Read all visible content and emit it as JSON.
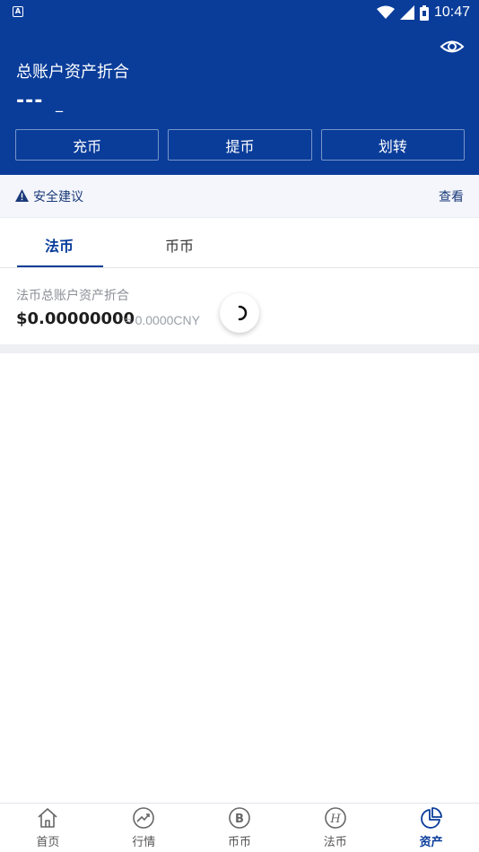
{
  "status_bar": {
    "time": "10:47",
    "app_icon_letter": "A"
  },
  "header": {
    "title": "总账户资产折合",
    "value": "---",
    "unit": "_",
    "actions": [
      "充币",
      "提币",
      "划转"
    ]
  },
  "notice": {
    "text": "安全建议",
    "link": "查看"
  },
  "tabs": [
    {
      "label": "法币",
      "active": true
    },
    {
      "label": "币币",
      "active": false
    }
  ],
  "balance": {
    "label": "法币总账户资产折合",
    "value": "$0.00000000",
    "cny": "≈ 0.0000CNY"
  },
  "bottom_nav": [
    {
      "label": "首页",
      "icon": "home-icon"
    },
    {
      "label": "行情",
      "icon": "trend-icon"
    },
    {
      "label": "币币",
      "icon": "bitcoin-icon"
    },
    {
      "label": "法币",
      "icon": "fiat-icon"
    },
    {
      "label": "资产",
      "icon": "pie-chart-icon",
      "active": true
    }
  ],
  "colors": {
    "primary": "#0a3d9a",
    "notice_bg": "#f4f6fb",
    "muted": "#8c8f96"
  }
}
